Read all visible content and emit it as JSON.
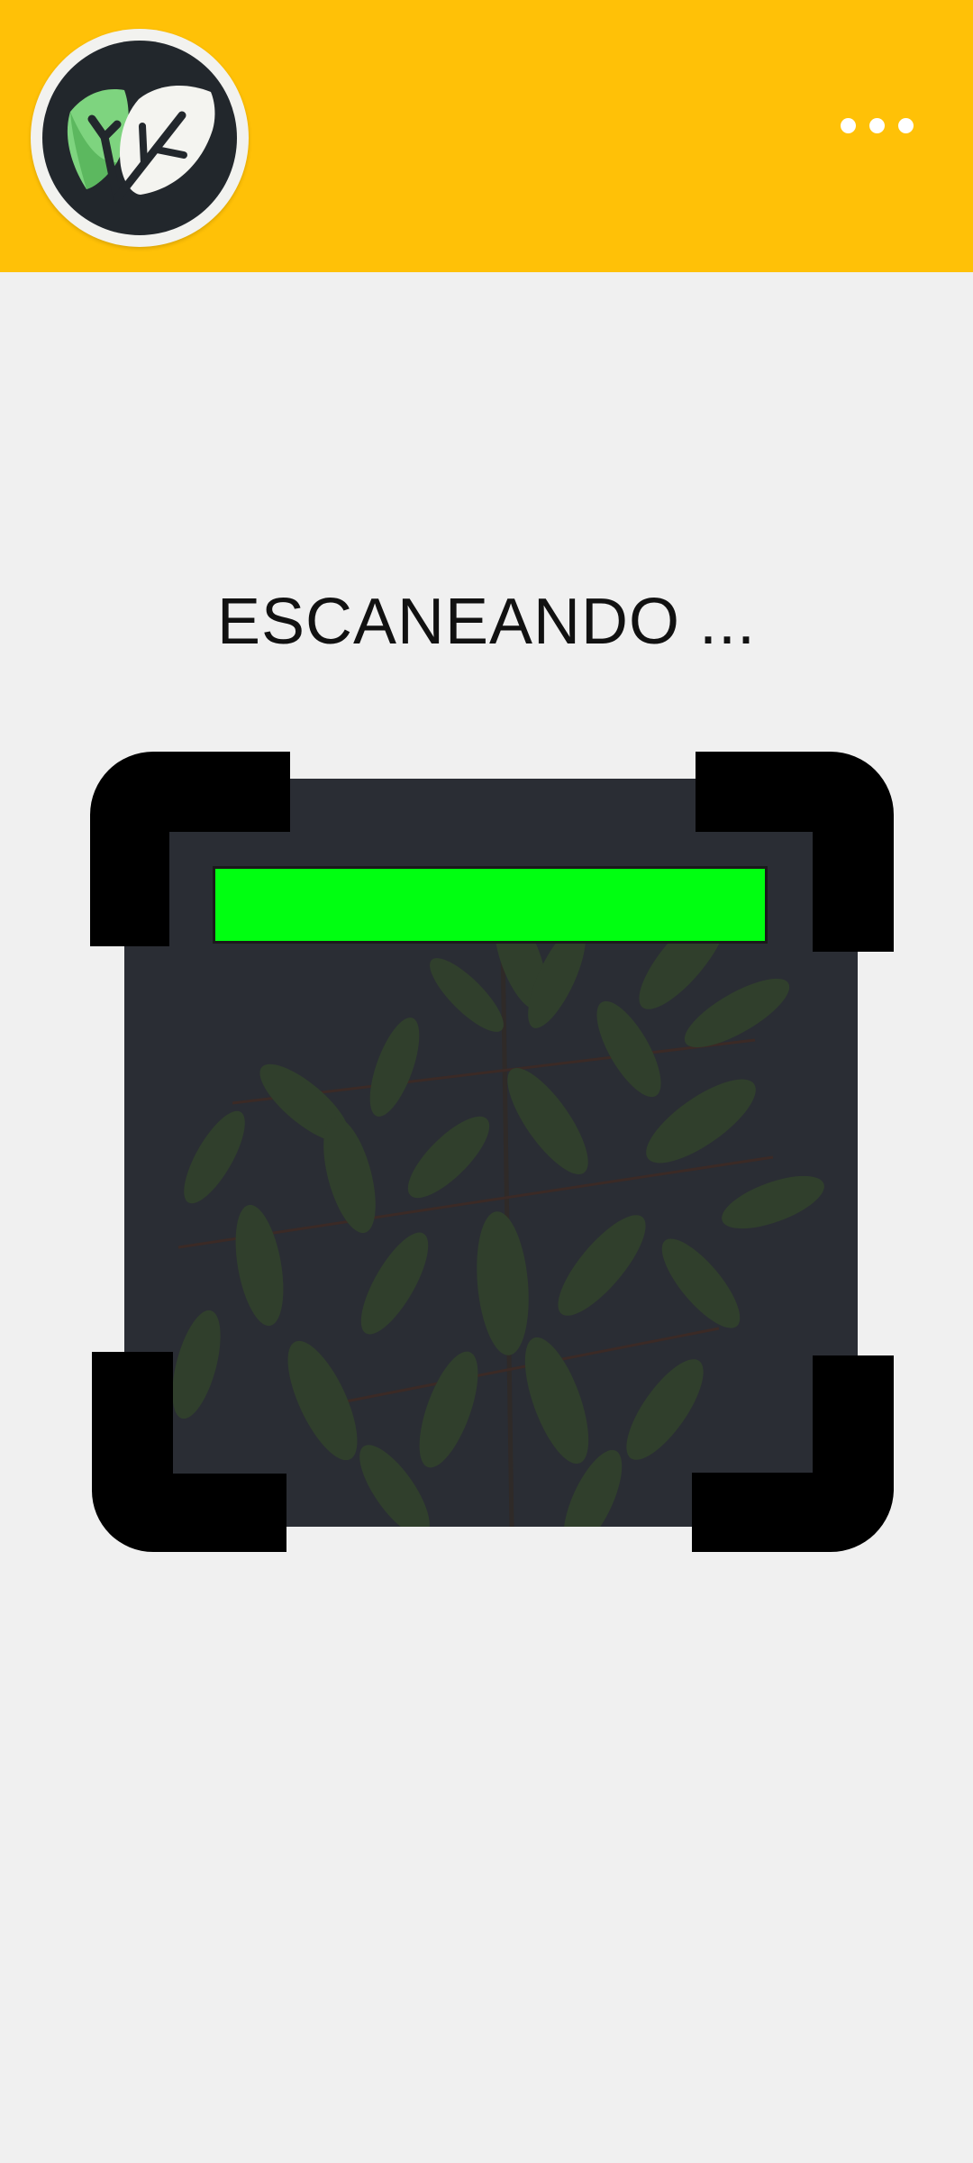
{
  "header": {
    "background_color": "#ffc107",
    "logo_icon": "leaf-logo-icon",
    "menu_icon": "more-horizontal-icon"
  },
  "scanner": {
    "title": "ESCANEANDO ...",
    "scan_bar_color": "#00ff11",
    "frame_color": "#000000",
    "preview_subject": "plant-photo"
  }
}
